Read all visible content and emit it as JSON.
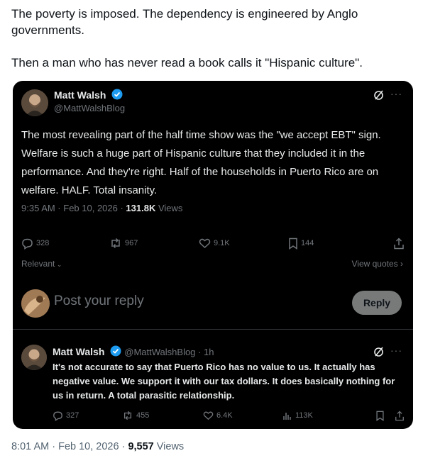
{
  "post": {
    "paragraph1": "The poverty is imposed. The dependency is engineered by Anglo governments.",
    "paragraph2": "Then a man who has never read a book calls it \"Hispanic culture\".",
    "time": "8:01 AM · Feb 10, 2026 · ",
    "views_count": "9,557",
    "views_label": " Views"
  },
  "quoted_tweet": {
    "author_name": "Matt Walsh",
    "author_handle": "@MattWalshBlog",
    "text": "The most revealing part of the half time show was the \"we accept EBT\" sign. Welfare is such a huge part of Hispanic culture that they included it in the performance. And they're right. Half of the households in Puerto Rico are on welfare. HALF. Total insanity.",
    "time": "9:35 AM · Feb 10, 2026 · ",
    "views_count": "131.8K",
    "views_label": " Views",
    "stats": {
      "replies": "328",
      "reposts": "967",
      "likes": "9.1K",
      "bookmarks": "144"
    }
  },
  "sort": {
    "label": "Relevant",
    "view_quotes": "View quotes"
  },
  "composer": {
    "placeholder": "Post your reply",
    "button": "Reply"
  },
  "reply": {
    "author_name": "Matt Walsh",
    "author_handle": "@MattWalshBlog · 1h",
    "text": "It's not accurate to say that Puerto Rico has no value to us. It actually has negative value. We support it with our tax dollars. It does basically nothing for us in return. A total parasitic relationship.",
    "stats": {
      "replies": "327",
      "reposts": "455",
      "likes": "6.4K",
      "views": "113K"
    }
  },
  "colors": {
    "verified": "#1d9bf0",
    "card_bg": "#000000",
    "muted": "#71767b"
  },
  "icons": [
    "grok-icon",
    "more-icon",
    "reply-icon",
    "repost-icon",
    "like-icon",
    "bookmark-icon",
    "share-icon",
    "views-icon",
    "verified-icon",
    "chevron-down-icon",
    "chevron-right-icon"
  ]
}
